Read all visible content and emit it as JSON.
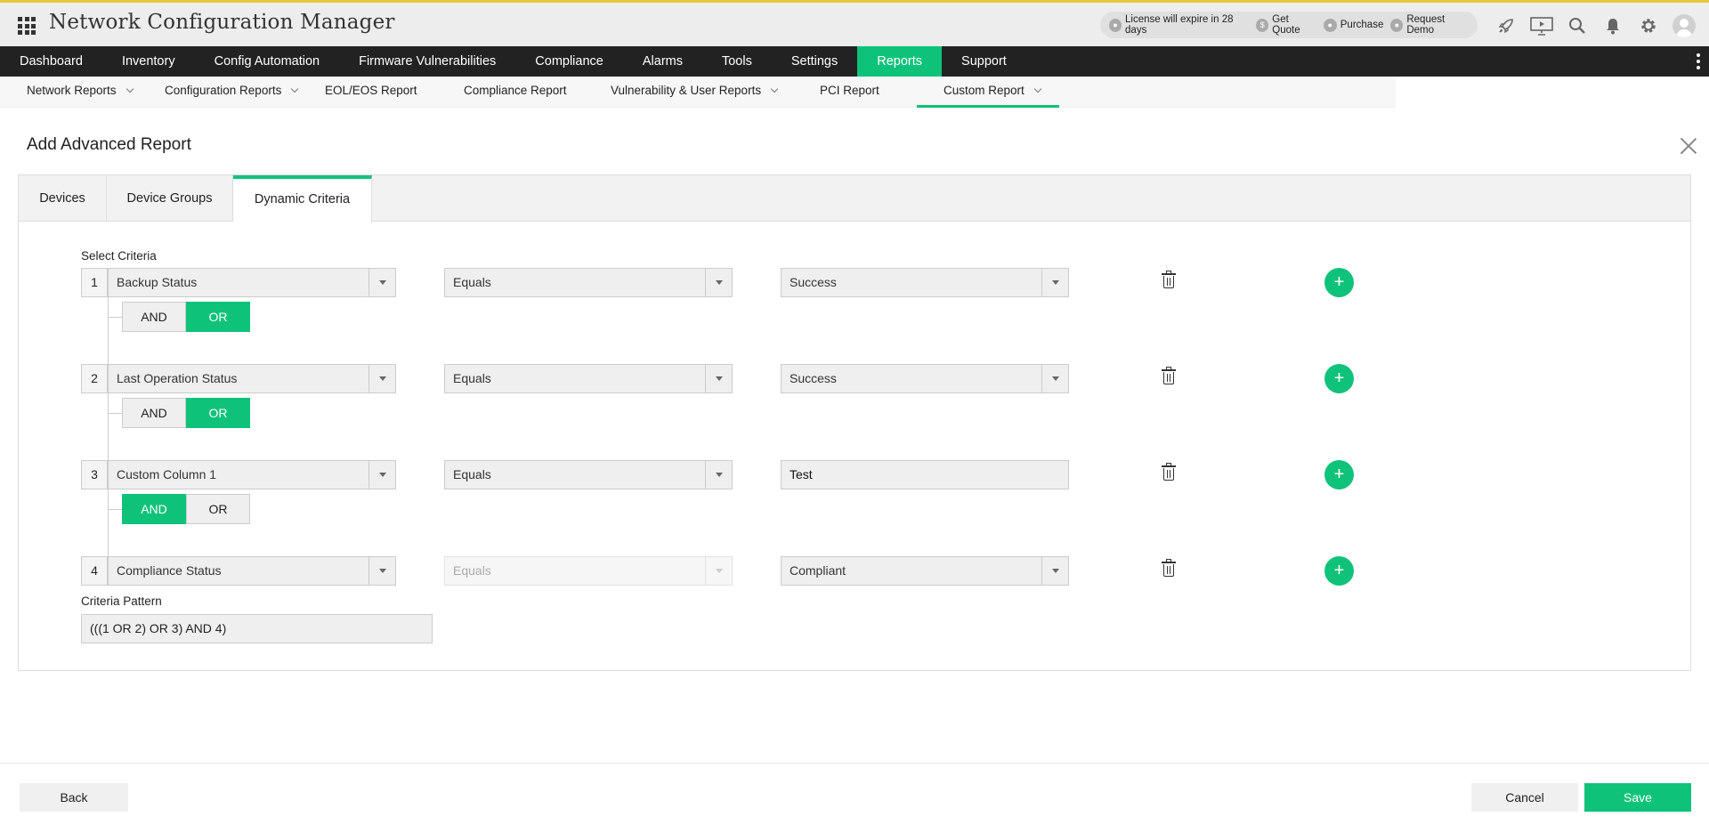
{
  "app": {
    "title": "Network Configuration Manager"
  },
  "license_bar": {
    "license_text": "License will expire in 28 days",
    "get_quote": "Get Quote",
    "purchase": "Purchase",
    "request_demo": "Request Demo"
  },
  "main_nav": [
    {
      "label": "Dashboard"
    },
    {
      "label": "Inventory"
    },
    {
      "label": "Config Automation"
    },
    {
      "label": "Firmware Vulnerabilities"
    },
    {
      "label": "Compliance"
    },
    {
      "label": "Alarms"
    },
    {
      "label": "Tools"
    },
    {
      "label": "Settings"
    },
    {
      "label": "Reports",
      "active": true
    },
    {
      "label": "Support"
    }
  ],
  "sub_nav": [
    {
      "label": "Network Reports",
      "dropdown": true
    },
    {
      "label": "Configuration Reports",
      "dropdown": true
    },
    {
      "label": "EOL/EOS Report"
    },
    {
      "label": "Compliance Report"
    },
    {
      "label": "Vulnerability & User Reports",
      "dropdown": true
    },
    {
      "label": "PCI Report"
    },
    {
      "label": "Custom Report",
      "dropdown": true,
      "active": true
    }
  ],
  "page": {
    "title": "Add Advanced Report"
  },
  "tabs": [
    {
      "label": "Devices"
    },
    {
      "label": "Device Groups"
    },
    {
      "label": "Dynamic Criteria",
      "active": true
    }
  ],
  "criteria": {
    "label": "Select Criteria",
    "rows": [
      {
        "num": "1",
        "field": "Backup Status",
        "operator": "Equals",
        "value": "Success",
        "value_type": "select"
      },
      {
        "num": "2",
        "field": "Last Operation Status",
        "operator": "Equals",
        "value": "Success",
        "value_type": "select"
      },
      {
        "num": "3",
        "field": "Custom Column 1",
        "operator": "Equals",
        "value": "Test",
        "value_type": "text"
      },
      {
        "num": "4",
        "field": "Compliance Status",
        "operator": "Equals",
        "operator_disabled": true,
        "value": "Compliant",
        "value_type": "select"
      }
    ],
    "connectors": [
      {
        "and_label": "AND",
        "or_label": "OR",
        "selected": "OR"
      },
      {
        "and_label": "AND",
        "or_label": "OR",
        "selected": "OR"
      },
      {
        "and_label": "AND",
        "or_label": "OR",
        "selected": "AND"
      }
    ],
    "add_symbol": "+"
  },
  "pattern": {
    "label": "Criteria Pattern",
    "value": "(((1 OR 2) OR 3) AND 4)"
  },
  "footer": {
    "back": "Back",
    "cancel": "Cancel",
    "save": "Save"
  },
  "colors": {
    "accent": "#0fc27a",
    "nav_bg": "#222222",
    "top_border": "#e8c93a"
  },
  "icons": [
    "apps-grid-icon",
    "rocket-icon",
    "presentation-icon",
    "search-icon",
    "bell-icon",
    "gear-icon",
    "avatar",
    "more-vertical-icon",
    "close-icon",
    "trash-icon",
    "plus-icon"
  ]
}
